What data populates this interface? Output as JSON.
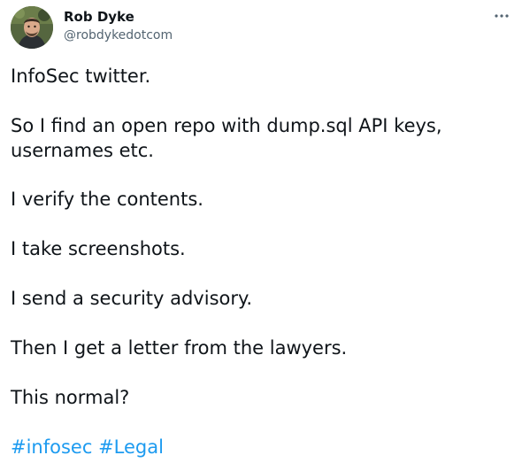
{
  "author": {
    "display_name": "Rob Dyke",
    "handle": "@robdykedotcom",
    "avatar_icon": "profile-photo"
  },
  "more_icon": "more-options-icon",
  "tweet": {
    "paragraphs": [
      "InfoSec twitter.",
      "So I find an open repo with dump.sql API keys,",
      "usernames etc.",
      "I verify the contents.",
      "I take screenshots.",
      "I send a security advisory.",
      "Then I get a letter from the lawyers.",
      "This normal?"
    ],
    "hashtags": [
      "#infosec",
      "#Legal"
    ]
  },
  "colors": {
    "text": "#0f1419",
    "secondary": "#536471",
    "link": "#1d9bf0",
    "background": "#ffffff"
  }
}
